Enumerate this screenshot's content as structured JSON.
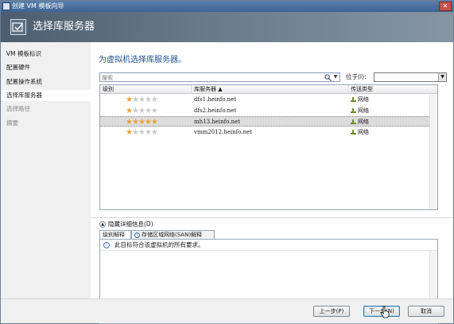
{
  "window": {
    "title": "创建 VM 模板向导",
    "close_glyph": "✕"
  },
  "banner": {
    "title": "选择库服务器"
  },
  "steps": [
    {
      "label": "VM 模板标识",
      "state": "done"
    },
    {
      "label": "配置硬件",
      "state": "done"
    },
    {
      "label": "配置操作系统",
      "state": "done"
    },
    {
      "label": "选择库服务器",
      "state": "current"
    },
    {
      "label": "选择路径",
      "state": "disabled"
    },
    {
      "label": "摘要",
      "state": "disabled"
    }
  ],
  "main": {
    "heading": "为虚拟机选择库服务器。",
    "search": {
      "placeholder": "搜索",
      "located_label": "位于(I):",
      "located_value": ""
    },
    "table": {
      "columns": [
        "级别",
        "库服务器 ▲",
        "传送类型"
      ],
      "rows": [
        {
          "rating": 1,
          "server": "dfs1.heinfo.net",
          "transfer": "网络",
          "selected": false
        },
        {
          "rating": 1,
          "server": "dfs2.heinfo.net",
          "transfer": "网络",
          "selected": false
        },
        {
          "rating": 5,
          "server": "mh13.heinfo.net",
          "transfer": "网络",
          "selected": true
        },
        {
          "rating": 1,
          "server": "vmm2012.heinfo.net",
          "transfer": "网络",
          "selected": false
        }
      ]
    },
    "details_toggle": "隐藏详细信息(D)",
    "tabs": [
      {
        "label": "级别解释",
        "active": true
      },
      {
        "label": "存储区域网络(SAN)解释",
        "active": false
      }
    ],
    "detail_message": "此目标符合该虚拟机的所有要求。"
  },
  "footer": {
    "back": "上一步(P)",
    "next": "下一步(N)",
    "cancel": "取消"
  },
  "colors": {
    "star_full": "#e8a43a",
    "star_empty": "#c8c8c8",
    "heading": "#1f4f94"
  }
}
